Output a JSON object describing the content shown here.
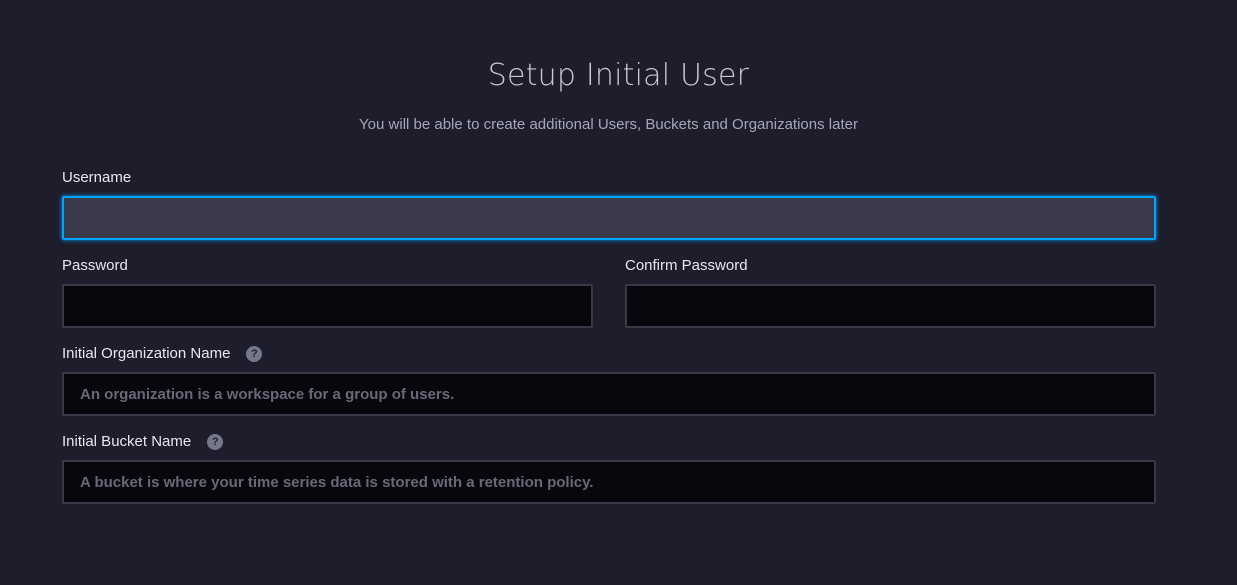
{
  "form": {
    "title": "Setup Initial User",
    "subtitle": "You will be able to create additional Users, Buckets and Organizations later",
    "username": {
      "label": "Username",
      "value": "",
      "placeholder": ""
    },
    "password": {
      "label": "Password",
      "value": "",
      "placeholder": ""
    },
    "confirm_password": {
      "label": "Confirm Password",
      "value": "",
      "placeholder": ""
    },
    "organization": {
      "label": "Initial Organization Name",
      "placeholder": "An organization is a workspace for a group of users.",
      "help_icon": "question-mark-icon"
    },
    "bucket": {
      "label": "Initial Bucket Name",
      "placeholder": "A bucket is where your time series data is stored with a retention policy.",
      "help_icon": "question-mark-icon"
    }
  },
  "colors": {
    "background": "#1e1d2c",
    "focus_border": "#00a3ff",
    "input_background": "#07070e"
  }
}
